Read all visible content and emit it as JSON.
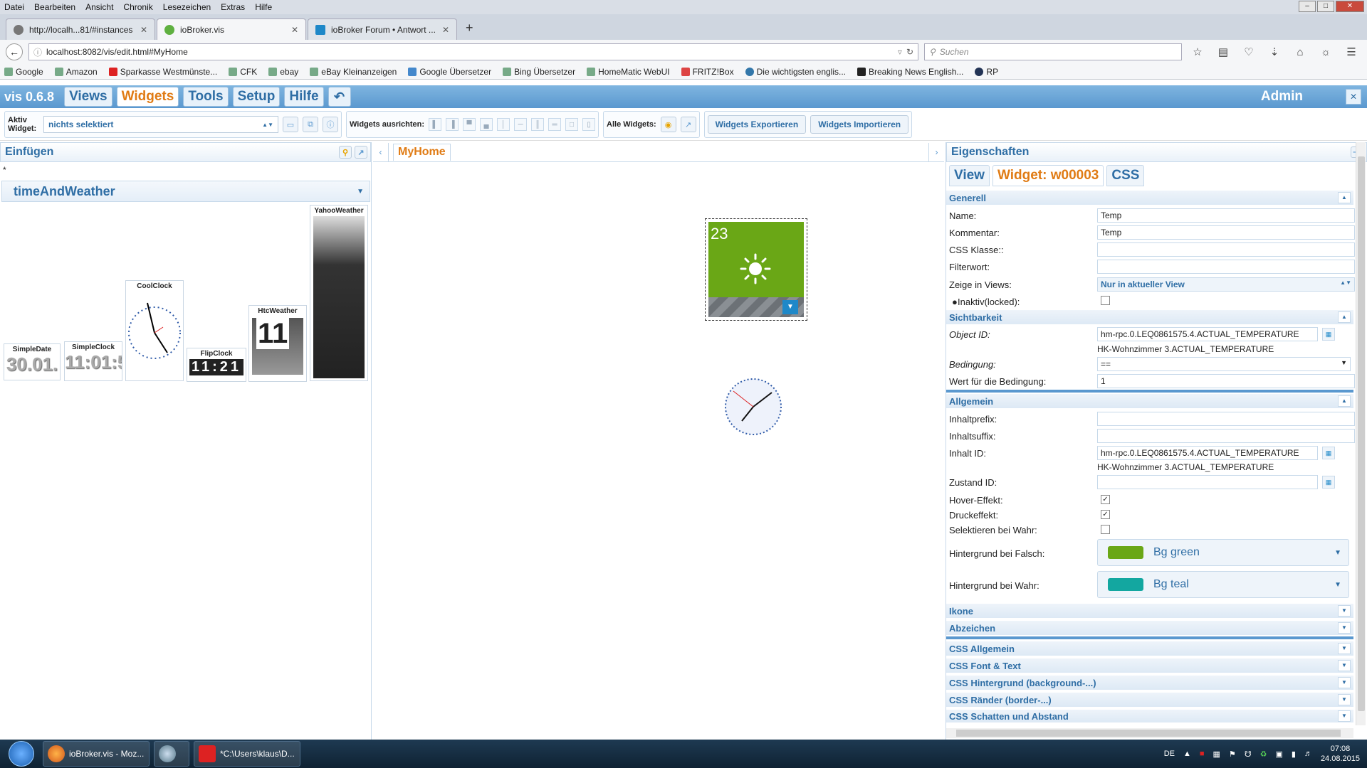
{
  "browser": {
    "menu": [
      "Datei",
      "Bearbeiten",
      "Ansicht",
      "Chronik",
      "Lesezeichen",
      "Extras",
      "Hilfe"
    ],
    "tabs": [
      {
        "title": "http://localh...81/#instances"
      },
      {
        "title": "ioBroker.vis"
      },
      {
        "title": "ioBroker Forum • Antwort ..."
      }
    ],
    "url": "localhost:8082/vis/edit.html#MyHome",
    "search_placeholder": "Suchen",
    "bookmarks": [
      "Google",
      "Amazon",
      "Sparkasse Westmünste...",
      "CFK",
      "ebay",
      "eBay Kleinanzeigen",
      "Google Übersetzer",
      "Bing Übersetzer",
      "HomeMatic WebUI",
      "FRITZ!Box",
      "Die wichtigsten englis...",
      "Breaking News English...",
      "RP"
    ]
  },
  "app": {
    "brand": "vis 0.6.8",
    "menu_tabs": [
      "Views",
      "Widgets",
      "Tools",
      "Setup",
      "Hilfe"
    ],
    "active_tab": "Widgets",
    "user": "Admin"
  },
  "toolbar": {
    "active_widget_label": "Aktiv Widget:",
    "active_widget_value": "nichts selektiert",
    "align_label": "Widgets ausrichten:",
    "all_widgets_label": "Alle Widgets:",
    "export_label": "Widgets Exportieren",
    "import_label": "Widgets Importieren"
  },
  "left_panel": {
    "title": "Einfügen",
    "filter_text": "*",
    "set_name": "timeAndWeather",
    "widgets": [
      {
        "name": "SimpleDate",
        "preview": "30.01."
      },
      {
        "name": "SimpleClock",
        "preview": "11:01:5"
      },
      {
        "name": "CoolClock",
        "preview": ""
      },
      {
        "name": "FlipClock",
        "preview": "11:21"
      },
      {
        "name": "HtcWeather",
        "preview": "11"
      },
      {
        "name": "YahooWeather",
        "preview": ""
      }
    ]
  },
  "canvas": {
    "view_tab": "MyHome",
    "tile_value": "23",
    "tile_color": "#6aa716"
  },
  "right_panel": {
    "title": "Eigenschaften",
    "tabs": [
      "View",
      "Widget: w00003",
      "CSS"
    ],
    "active_tab": "Widget: w00003",
    "sections": {
      "general": "Generell",
      "visibility": "Sichtbarkeit",
      "common": "Allgemein",
      "icon": "Ikone",
      "badge": "Abzeichen",
      "css_common": "CSS Allgemein",
      "css_font": "CSS Font & Text",
      "css_bg": "CSS Hintergrund (background-...)",
      "css_border": "CSS Ränder (border-...)",
      "css_shadow": "CSS Schatten und Abstand"
    },
    "fields": {
      "name_label": "Name:",
      "name_value": "Temp",
      "comment_label": "Kommentar:",
      "comment_value": "Temp",
      "css_class_label": "CSS Klasse::",
      "css_class_value": "",
      "filter_label": "Filterwort:",
      "filter_value": "",
      "views_label": "Zeige in Views:",
      "views_value": "Nur in aktueller View",
      "locked_label": "Inaktiv(locked):",
      "locked_checked": false,
      "object_id_label": "Object ID:",
      "object_id_value": "hm-rpc.0.LEQ0861575.4.ACTUAL_TEMPERATURE",
      "object_id_desc": "HK-Wohnzimmer 3.ACTUAL_TEMPERATURE",
      "condition_label": "Bedingung:",
      "condition_value": "==",
      "condition_value_label": "Wert für die Bedingung:",
      "condition_value_value": "1",
      "prefix_label": "Inhaltprefix:",
      "prefix_value": "",
      "suffix_label": "Inhaltsuffix:",
      "suffix_value": "",
      "content_id_label": "Inhalt ID:",
      "content_id_value": "hm-rpc.0.LEQ0861575.4.ACTUAL_TEMPERATURE",
      "content_id_desc": "HK-Wohnzimmer 3.ACTUAL_TEMPERATURE",
      "state_id_label": "Zustand ID:",
      "state_id_value": "",
      "hover_label": "Hover-Effekt:",
      "hover_checked": true,
      "press_label": "Druckeffekt:",
      "press_checked": true,
      "select_true_label": "Selektieren bei Wahr:",
      "select_true_checked": false,
      "bg_false_label": "Hintergrund bei Falsch:",
      "bg_false_value": "Bg green",
      "bg_false_color": "#6aa716",
      "bg_true_label": "Hintergrund bei Wahr:",
      "bg_true_value": "Bg teal",
      "bg_true_color": "#13a7a0"
    }
  },
  "taskbar": {
    "tasks": [
      "ioBroker.vis - Moz...",
      "",
      "*C:\\Users\\klaus\\D..."
    ],
    "lang": "DE",
    "time": "07:08",
    "date": "24.08.2015"
  }
}
